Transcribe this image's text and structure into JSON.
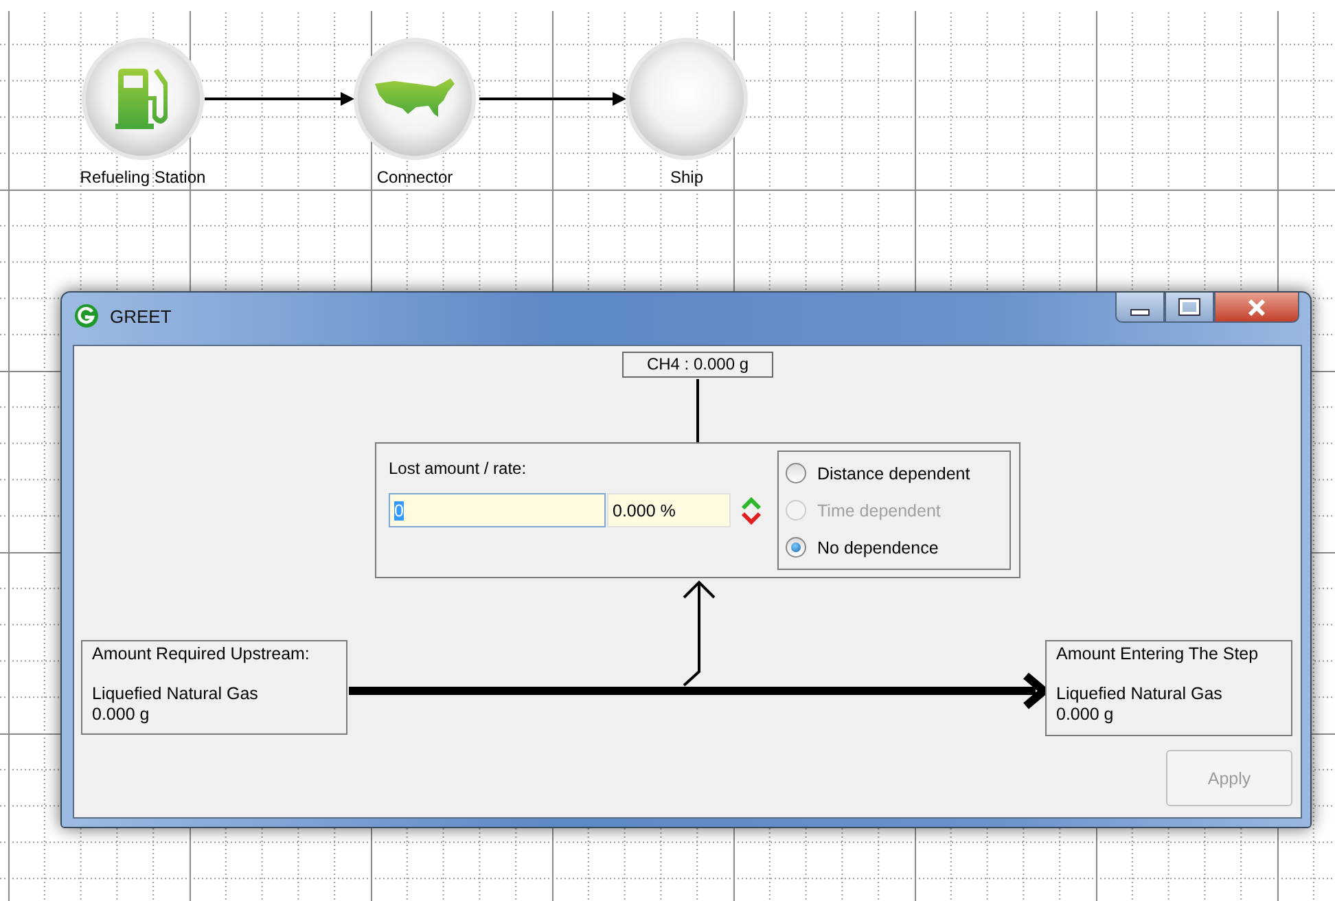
{
  "canvas": {
    "nodes": [
      {
        "label": "Refueling Station",
        "kind": "pump"
      },
      {
        "label": "Connector",
        "kind": "map"
      },
      {
        "label": "Ship",
        "kind": "empty"
      }
    ]
  },
  "dialog": {
    "title": "GREET",
    "emission_label": "CH4 : 0.000 g",
    "loss": {
      "label": "Lost amount / rate:",
      "value": "0",
      "rate": "0.000 %"
    },
    "dependence": [
      {
        "label": "Distance dependent",
        "selected": false,
        "disabled": false
      },
      {
        "label": "Time dependent",
        "selected": false,
        "disabled": true
      },
      {
        "label": "No dependence",
        "selected": true,
        "disabled": false
      }
    ],
    "upstream": {
      "heading": "Amount Required Upstream:",
      "resource": "Liquefied Natural Gas",
      "amount": "0.000 g"
    },
    "entering": {
      "heading": "Amount Entering The Step",
      "resource": "Liquefied Natural Gas",
      "amount": "0.000 g"
    },
    "apply": {
      "label": "Apply",
      "disabled": true
    }
  }
}
